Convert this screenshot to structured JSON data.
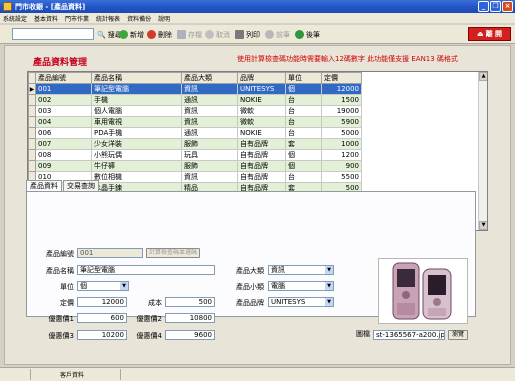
{
  "window": {
    "title": "門市收銀 - [產品資料]"
  },
  "menu": [
    "系統設定",
    "基本資料",
    "門市作業",
    "統計報表",
    "資料備份",
    "說明"
  ],
  "toolbar": {
    "search_value": "",
    "search_label": "搜尋",
    "add_label": "新增",
    "delete_label": "刪除",
    "save_label": "存檔",
    "cancel_label": "取消",
    "print_label": "列印",
    "prev_label": "前筆",
    "next_label": "後筆",
    "exit_label": "離 開"
  },
  "page": {
    "title": "產品資料管理",
    "notice": "使用計算檢查碼功能時需要輸入12碼數字 此功能僅支援 EAN13 碼格式"
  },
  "grid": {
    "columns": [
      "產品編號",
      "產品名稱",
      "產品大類",
      "品牌",
      "單位",
      "定價"
    ],
    "rows": [
      [
        "001",
        "筆記型電腦",
        "資訊",
        "UNITESYS",
        "個",
        "12000"
      ],
      [
        "002",
        "手機",
        "通訊",
        "NOKIE",
        "台",
        "1500"
      ],
      [
        "003",
        "個人電腦",
        "資訊",
        "微軟",
        "台",
        "19000"
      ],
      [
        "004",
        "車用電視",
        "資訊",
        "微軟",
        "台",
        "5900"
      ],
      [
        "006",
        "PDA手機",
        "通訊",
        "NOKIE",
        "台",
        "5000"
      ],
      [
        "007",
        "少女洋裝",
        "服飾",
        "自有品牌",
        "套",
        "1000"
      ],
      [
        "008",
        "小熊玩偶",
        "玩具",
        "自有品牌",
        "個",
        "1200"
      ],
      [
        "009",
        "牛仔褲",
        "服飾",
        "自有品牌",
        "個",
        "900"
      ],
      [
        "010",
        "數位相機",
        "資訊",
        "自有品牌",
        "台",
        "5500"
      ],
      [
        "011",
        "水晶手鍊",
        "精品",
        "自有品牌",
        "套",
        "500"
      ]
    ]
  },
  "tabs": [
    "產品資料",
    "交易查詢"
  ],
  "form": {
    "code_label": "產品編號",
    "code_value": "001",
    "calc_button": "計算檢查碼並選碼",
    "name_label": "產品名稱",
    "name_value": "筆記型電腦",
    "unit_label": "單位",
    "unit_value": "個",
    "price_label": "定價",
    "price_value": "12000",
    "cost_label": "成本",
    "cost_value": "500",
    "disc1_label": "優惠價1",
    "disc1_value": "600",
    "disc2_label": "優惠價2",
    "disc2_value": "10800",
    "disc3_label": "優惠價3",
    "disc3_value": "10200",
    "disc4_label": "優惠價4",
    "disc4_value": "9600",
    "category_label": "產品大類",
    "category_value": "資訊",
    "subcategory_label": "產品小類",
    "subcategory_value": "電腦",
    "brand_label": "產品品牌",
    "brand_value": "UNITESYS",
    "image_label": "圖檔",
    "image_value": "st-1365567-a200.jpg",
    "browse_button": "瀏覽"
  },
  "status": {
    "text": "客戶資料"
  }
}
